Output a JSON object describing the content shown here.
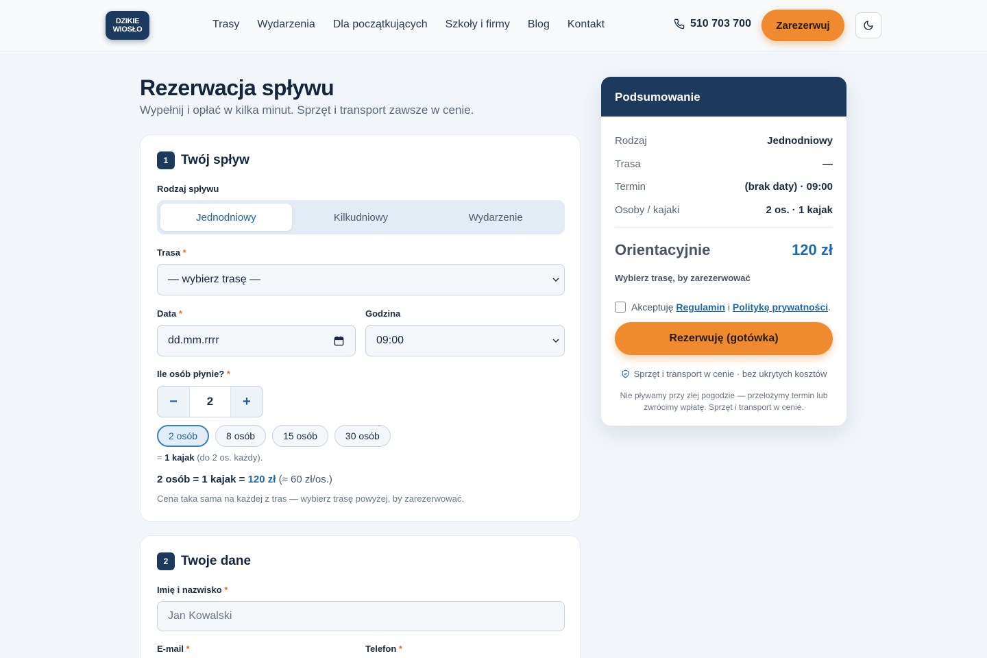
{
  "header": {
    "logo_line1": "DZIKIE",
    "logo_line2": "WIOSŁO",
    "nav": [
      "Trasy",
      "Wydarzenia",
      "Dla początkujących",
      "Szkoły i firmy",
      "Blog",
      "Kontakt"
    ],
    "phone": "510 703 700",
    "reserve_label": "Zarezerwuj",
    "theme_icon": "moon-icon"
  },
  "page": {
    "title": "Rezerwacja spływu",
    "subtitle": "Wypełnij i opłać w kilka minut. Sprzęt i transport zawsze w cenie."
  },
  "step1": {
    "num": "1",
    "title": "Twój spływ",
    "type_label": "Rodzaj spływu",
    "types": [
      "Jednodniowy",
      "Kilkudniowy",
      "Wydarzenie"
    ],
    "route_label": "Trasa",
    "route_value": "— wybierz trasę —",
    "date_label": "Data",
    "date_placeholder": "dd.mm.rrrr",
    "time_label": "Godzina",
    "time_value": "09:00",
    "people_label": "Ile osób płynie?",
    "people_value": "2",
    "minus": "−",
    "plus": "+",
    "chips": [
      "2 osób",
      "8 osób",
      "15 osób",
      "30 osób"
    ],
    "kayak_prefix": "=",
    "kayak_bold": "1 kajak",
    "kayak_suffix": "(do 2 os. każdy).",
    "calc_bold": "2 osób = 1 kajak =",
    "calc_price": "120 zł",
    "calc_per": "(≈ 60 zł/os.)",
    "hint": "Cena taka sama na każdej z tras — wybierz trasę powyżej, by zarezerwować.",
    "required_mark": "*"
  },
  "step2": {
    "num": "2",
    "title": "Twoje dane",
    "name_label": "Imię i nazwisko",
    "name_placeholder": "Jan Kowalski",
    "email_label": "E-mail",
    "phone_label": "Telefon"
  },
  "summary": {
    "title": "Podsumowanie",
    "rows": [
      {
        "k": "Rodzaj",
        "v": "Jednodniowy"
      },
      {
        "k": "Trasa",
        "v": "—"
      },
      {
        "k": "Termin",
        "v": "(brak daty) · 09:00"
      },
      {
        "k": "Osoby / kajaki",
        "v": "2 os. · 1 kajak"
      }
    ],
    "total_label": "Orientacyjnie",
    "total_value": "120 zł",
    "pick_note": "Wybierz trasę, by zarezerwować",
    "accept_prefix": "Akceptuję",
    "accept_link1": "Regulamin",
    "accept_and": "i",
    "accept_link2": "Politykę prywatności",
    "accept_end": ".",
    "button": "Rezerwuję (gotówka)",
    "guarantee": "Sprzęt i transport w cenie · bez ukrytych kosztów",
    "weather": "Nie pływamy przy złej pogodzie — przełożymy termin lub zwrócimy wpłatę. Sprzęt i transport w cenie."
  },
  "colors": {
    "navy": "#1b3a5e",
    "orange": "#ef8a2e",
    "blue": "#1e6aa8"
  }
}
